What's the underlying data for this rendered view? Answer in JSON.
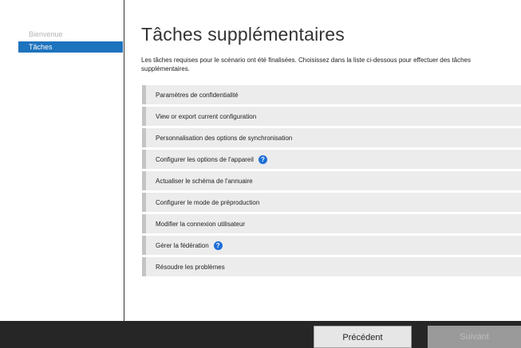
{
  "sidebar": {
    "items": [
      {
        "label": "Bienvenue"
      },
      {
        "label": "Tâches"
      }
    ]
  },
  "main": {
    "title": "Tâches supplémentaires",
    "description": "Les tâches requises pour le scénario ont été finalisées. Choisissez dans la liste ci-dessous pour effectuer des tâches supplémentaires.",
    "tasks": [
      {
        "label": "Paramètres de confidentialité"
      },
      {
        "label": "View or export current configuration"
      },
      {
        "label": "Personnalisation des options de synchronisation"
      },
      {
        "label": "Configurer les options de l'appareil",
        "help_icon": "?"
      },
      {
        "label": "Actualiser le schéma de l'annuaire"
      },
      {
        "label": "Configurer le mode de préproduction"
      },
      {
        "label": "Modifier la connexion utilisateur"
      },
      {
        "label": "Gérer la fédération",
        "help_icon": "?"
      },
      {
        "label": "Résoudre les problèmes"
      }
    ]
  },
  "footer": {
    "prev_label": "Précédent",
    "next_label": "Suivant"
  },
  "colors": {
    "accent": "#1e73be",
    "help_icon": "#1e6fd9",
    "footer_bg": "#262626"
  }
}
